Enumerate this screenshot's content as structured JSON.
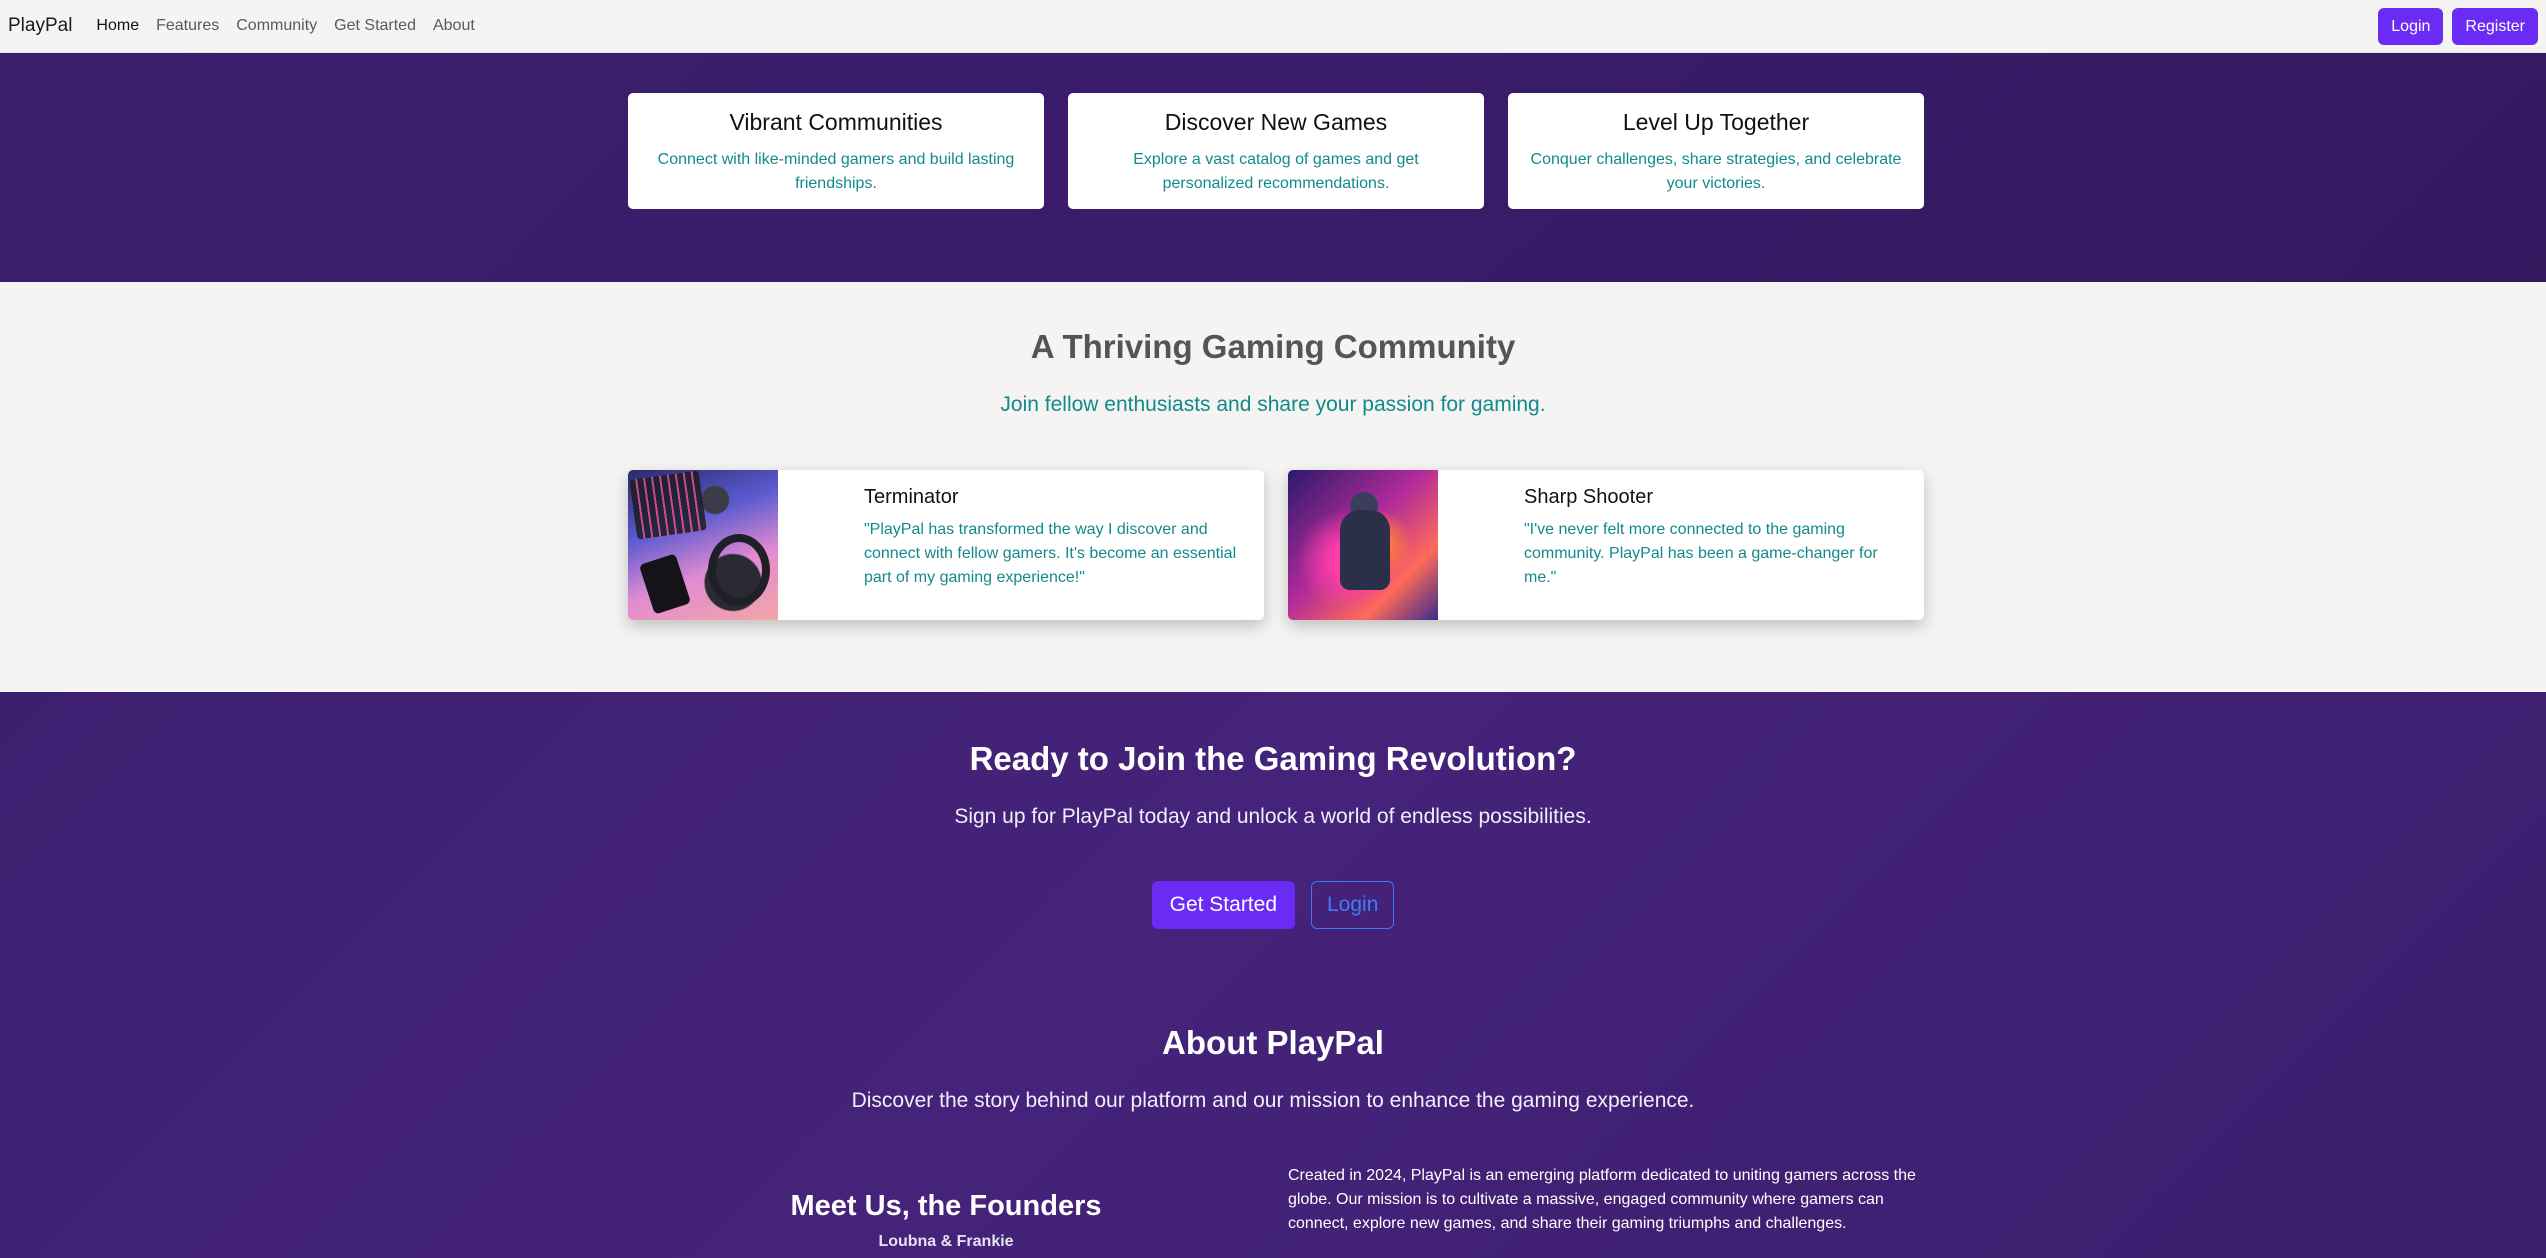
{
  "nav": {
    "brand": "PlayPal",
    "links": [
      "Home",
      "Features",
      "Community",
      "Get Started",
      "About"
    ],
    "login": "Login",
    "register": "Register"
  },
  "features": [
    {
      "title": "Vibrant Communities",
      "text": "Connect with like-minded gamers and build lasting friendships."
    },
    {
      "title": "Discover New Games",
      "text": "Explore a vast catalog of games and get personalized recommendations."
    },
    {
      "title": "Level Up Together",
      "text": "Conquer challenges, share strategies, and celebrate your victories."
    }
  ],
  "community": {
    "title": "A Thriving Gaming Community",
    "subtitle": "Join fellow enthusiasts and share your passion for gaming.",
    "testimonials": [
      {
        "name": "Terminator",
        "quote": "\"PlayPal has transformed the way I discover and connect with fellow gamers. It's become an essential part of my gaming experience!\""
      },
      {
        "name": "Sharp Shooter",
        "quote": "\"I've never felt more connected to the gaming community. PlayPal has been a game-changer for me.\""
      }
    ]
  },
  "cta": {
    "title": "Ready to Join the Gaming Revolution?",
    "subtitle": "Sign up for PlayPal today and unlock a world of endless possibilities.",
    "primary": "Get Started",
    "secondary": "Login"
  },
  "about": {
    "title": "About PlayPal",
    "subtitle": "Discover the story behind our platform and our mission to enhance the gaming experience.",
    "founders_title": "Meet Us, the Founders",
    "founders_names": "Loubna & Frankie",
    "text": "Created in 2024, PlayPal is an emerging platform dedicated to uniting gamers across the globe. Our mission is to cultivate a massive, engaged community where gamers can connect, explore new games, and share their gaming triumphs and challenges."
  },
  "colors": {
    "accent": "#6a2bf5",
    "teal_text": "#138a8a",
    "band_purple": "#3d1f70",
    "outline_blue": "#3b78f5"
  }
}
